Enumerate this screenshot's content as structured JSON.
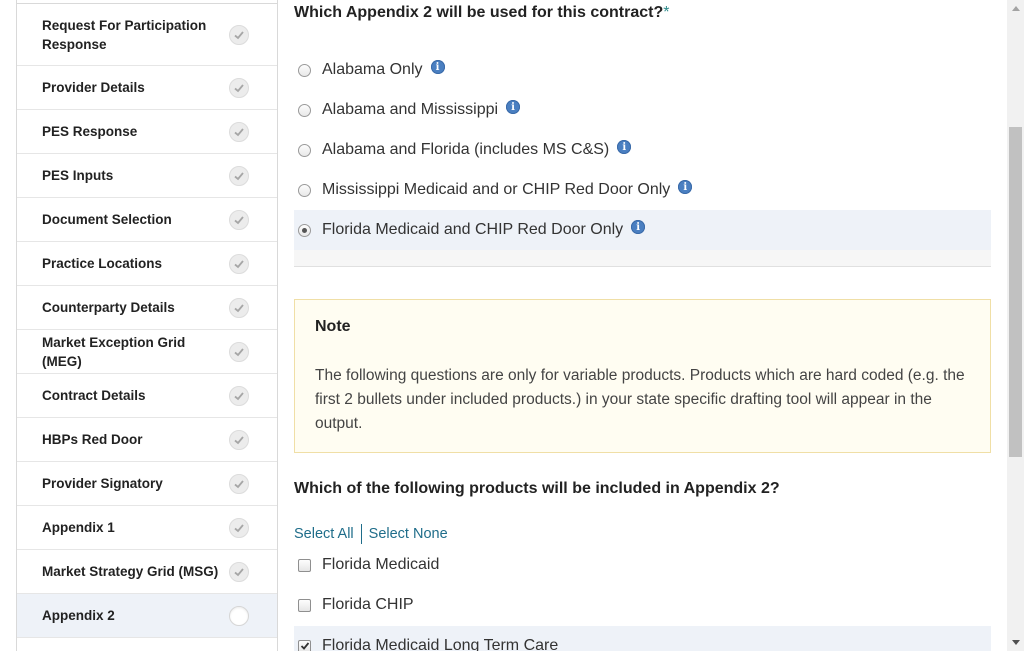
{
  "sidebar": {
    "items": [
      {
        "label": "Request For Participation Response",
        "state": "complete"
      },
      {
        "label": "Provider Details",
        "state": "complete"
      },
      {
        "label": "PES Response",
        "state": "complete"
      },
      {
        "label": "PES Inputs",
        "state": "complete"
      },
      {
        "label": "Document Selection",
        "state": "complete"
      },
      {
        "label": "Practice Locations",
        "state": "complete"
      },
      {
        "label": "Counterparty Details",
        "state": "complete"
      },
      {
        "label": "Market Exception Grid (MEG)",
        "state": "complete"
      },
      {
        "label": "Contract Details",
        "state": "complete"
      },
      {
        "label": "HBPs Red Door",
        "state": "complete"
      },
      {
        "label": "Provider Signatory",
        "state": "complete"
      },
      {
        "label": "Appendix 1",
        "state": "complete"
      },
      {
        "label": "Market Strategy Grid (MSG)",
        "state": "complete"
      },
      {
        "label": "Appendix 2",
        "state": "current"
      }
    ]
  },
  "question1": {
    "title": "Which Appendix 2 will be used for this contract?",
    "required_marker": "*",
    "options": [
      {
        "label": "Alabama Only",
        "selected": false
      },
      {
        "label": "Alabama and Mississippi",
        "selected": false
      },
      {
        "label": "Alabama and Florida (includes MS C&S)",
        "selected": false
      },
      {
        "label": "Mississippi Medicaid and or CHIP Red Door Only",
        "selected": false
      },
      {
        "label": "Florida Medicaid and CHIP Red Door Only",
        "selected": true
      }
    ],
    "info_glyph": "i"
  },
  "note": {
    "title": "Note",
    "body": "The following questions are only for variable products. Products which are hard coded (e.g. the first 2 bullets under included products.) in your state specific drafting tool will appear in the output."
  },
  "question2": {
    "title": "Which of the following products will be included in Appendix 2?",
    "select_all": "Select All",
    "select_none": "Select None",
    "options": [
      {
        "label": "Florida Medicaid",
        "checked": false
      },
      {
        "label": "Florida CHIP",
        "checked": false
      },
      {
        "label": "Florida Medicaid Long Term Care",
        "checked": true
      }
    ]
  },
  "colors": {
    "accent_link": "#1f6d8a",
    "selected_row": "#eef2f8",
    "note_bg": "#fffdf2",
    "note_border": "#f0dfa6",
    "info_icon": "#4a7fc1"
  }
}
